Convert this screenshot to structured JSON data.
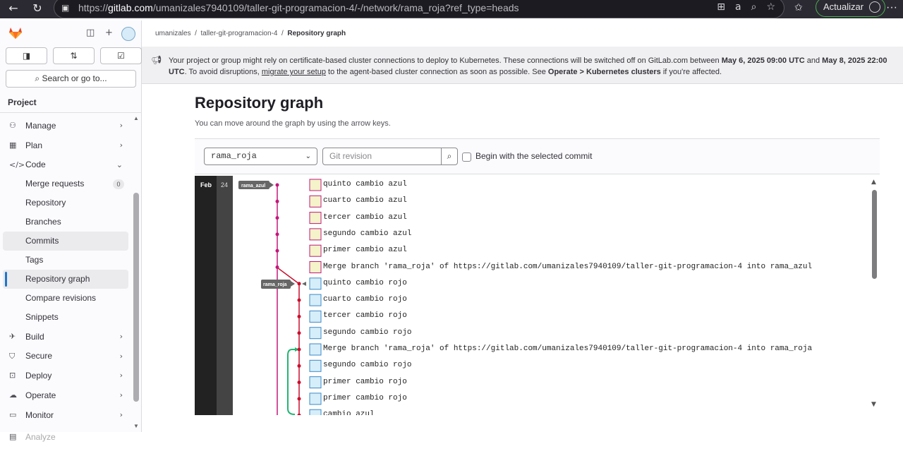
{
  "browser": {
    "url_prefix": "https://",
    "url_host": "gitlab.com",
    "url_path": "/umanizales7940109/taller-git-programacion-4/-/network/rama_roja?ref_type=heads",
    "update_label": "Actualizar"
  },
  "sidebar": {
    "search_placeholder": "Search or go to...",
    "section_title": "Project",
    "merge_requests_count": "0",
    "items": [
      {
        "label": "Manage",
        "icon": "users-icon",
        "type": "group"
      },
      {
        "label": "Plan",
        "icon": "calendar-icon",
        "type": "group"
      },
      {
        "label": "Code",
        "icon": "code-icon",
        "type": "group-open"
      },
      {
        "label": "Merge requests",
        "type": "sub"
      },
      {
        "label": "Repository",
        "type": "sub"
      },
      {
        "label": "Branches",
        "type": "sub"
      },
      {
        "label": "Commits",
        "type": "sub"
      },
      {
        "label": "Tags",
        "type": "sub"
      },
      {
        "label": "Repository graph",
        "type": "sub-active"
      },
      {
        "label": "Compare revisions",
        "type": "sub"
      },
      {
        "label": "Snippets",
        "type": "sub"
      },
      {
        "label": "Build",
        "icon": "rocket-icon",
        "type": "group"
      },
      {
        "label": "Secure",
        "icon": "shield-icon",
        "type": "group"
      },
      {
        "label": "Deploy",
        "icon": "deploy-icon",
        "type": "group"
      },
      {
        "label": "Operate",
        "icon": "cloud-icon",
        "type": "group"
      },
      {
        "label": "Monitor",
        "icon": "monitor-icon",
        "type": "group"
      },
      {
        "label": "Analyze",
        "icon": "chart-icon",
        "type": "group"
      }
    ]
  },
  "breadcrumb": {
    "user": "umanizales",
    "project": "taller-git-programacion-4",
    "current": "Repository graph"
  },
  "alert": {
    "part1": "Your project or group might rely on certificate-based cluster connections to deploy to Kubernetes. These connections will be switched off on GitLab.com between ",
    "date1": "May 6, 2025 09:00 UTC",
    "and": " and ",
    "date2": "May 8, 2025 22:00 UTC",
    "part2": ". To avoid disruptions, ",
    "link": "migrate your setup",
    "part3": " to the agent-based cluster connection as soon as possible. See ",
    "path": "Operate > Kubernetes clusters",
    "part4": " if you're affected."
  },
  "page": {
    "title": "Repository graph",
    "subtitle": "You can move around the graph by using the arrow keys."
  },
  "controls": {
    "branch": "rama_roja",
    "revision_placeholder": "Git revision",
    "checkbox_label": "Begin with the selected commit"
  },
  "graph": {
    "month": "Feb",
    "day": "24",
    "colors": {
      "azul": "#c2187a",
      "roja": "#c8102e",
      "merge": "#22b573"
    },
    "labels": [
      "rama_azul",
      "rama_roja"
    ],
    "commits": [
      {
        "message": "quinto cambio azul",
        "branch": "azul"
      },
      {
        "message": "cuarto cambio azul",
        "branch": "azul"
      },
      {
        "message": "tercer cambio azul",
        "branch": "azul"
      },
      {
        "message": "segundo cambio azul",
        "branch": "azul"
      },
      {
        "message": "primer cambio azul",
        "branch": "azul"
      },
      {
        "message": "Merge branch 'rama_roja' of https://gitlab.com/umanizales7940109/taller-git-programacion-4 into rama_azul",
        "branch": "azul"
      },
      {
        "message": "quinto cambio rojo",
        "branch": "roja"
      },
      {
        "message": "cuarto cambio rojo",
        "branch": "roja"
      },
      {
        "message": "tercer cambio rojo",
        "branch": "roja"
      },
      {
        "message": "segundo cambio rojo",
        "branch": "roja"
      },
      {
        "message": "Merge branch 'rama_roja' of https://gitlab.com/umanizales7940109/taller-git-programacion-4 into rama_roja",
        "branch": "roja"
      },
      {
        "message": "segundo cambio rojo",
        "branch": "roja"
      },
      {
        "message": "primer cambio rojo",
        "branch": "roja"
      },
      {
        "message": "primer cambio rojo",
        "branch": "roja"
      },
      {
        "message": "cambio azul",
        "branch": "roja"
      }
    ]
  }
}
